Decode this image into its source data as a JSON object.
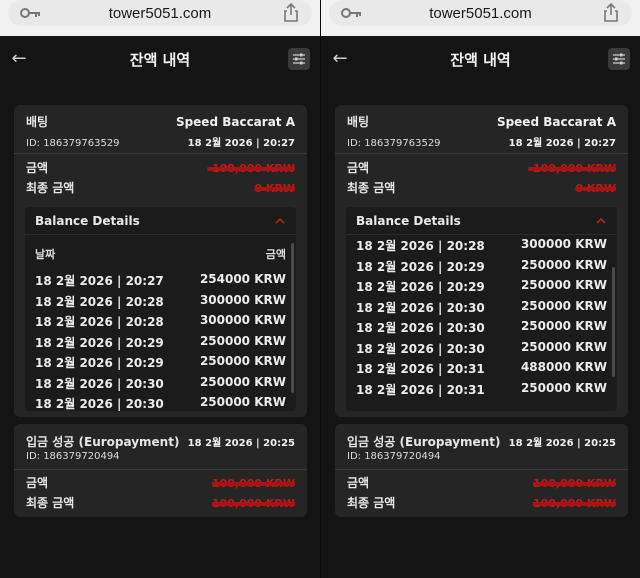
{
  "browser": {
    "url": "tower5051.com"
  },
  "header": {
    "back": "←",
    "title": "잔액 내역"
  },
  "bet_card": {
    "type_label": "배팅",
    "game": "Speed Baccarat A",
    "id_text": "ID: 186379763529",
    "datetime": "18 2월 2026 | 20:27",
    "amount_label": "금액",
    "amount_value": "-100,000 KRW",
    "final_label": "최종 금액",
    "final_value": "0 KRW"
  },
  "balance_details": {
    "title": "Balance Details",
    "col_date": "날짜",
    "col_amount": "금액",
    "left_rows": [
      {
        "date": "18 2월 2026 | 20:27",
        "amount": "254000 KRW"
      },
      {
        "date": "18 2월 2026 | 20:28",
        "amount": "300000 KRW"
      },
      {
        "date": "18 2월 2026 | 20:28",
        "amount": "300000 KRW"
      },
      {
        "date": "18 2월 2026 | 20:29",
        "amount": "250000 KRW"
      },
      {
        "date": "18 2월 2026 | 20:29",
        "amount": "250000 KRW"
      },
      {
        "date": "18 2월 2026 | 20:30",
        "amount": "250000 KRW"
      },
      {
        "date": "18 2월 2026 | 20:30",
        "amount": "250000 KRW"
      }
    ],
    "right_rows": [
      {
        "date": "18 2월 2026 | 20:28",
        "amount": "300000 KRW"
      },
      {
        "date": "18 2월 2026 | 20:29",
        "amount": "250000 KRW"
      },
      {
        "date": "18 2월 2026 | 20:29",
        "amount": "250000 KRW"
      },
      {
        "date": "18 2월 2026 | 20:30",
        "amount": "250000 KRW"
      },
      {
        "date": "18 2월 2026 | 20:30",
        "amount": "250000 KRW"
      },
      {
        "date": "18 2월 2026 | 20:30",
        "amount": "250000 KRW"
      },
      {
        "date": "18 2월 2026 | 20:31",
        "amount": "488000 KRW"
      },
      {
        "date": "18 2월 2026 | 20:31",
        "amount": "250000 KRW"
      }
    ]
  },
  "deposit_card": {
    "type_label": "입금 성공 (Europayment)",
    "id_text": "ID: 186379720494",
    "datetime": "18 2월 2026 | 20:25",
    "amount_label": "금액",
    "amount_value": "100,000 KRW",
    "final_label": "최종 금액",
    "final_value": "100,000 KRW"
  },
  "colors": {
    "accent_red": "#c21818",
    "card_bg": "#252525",
    "page_bg": "#141414"
  }
}
